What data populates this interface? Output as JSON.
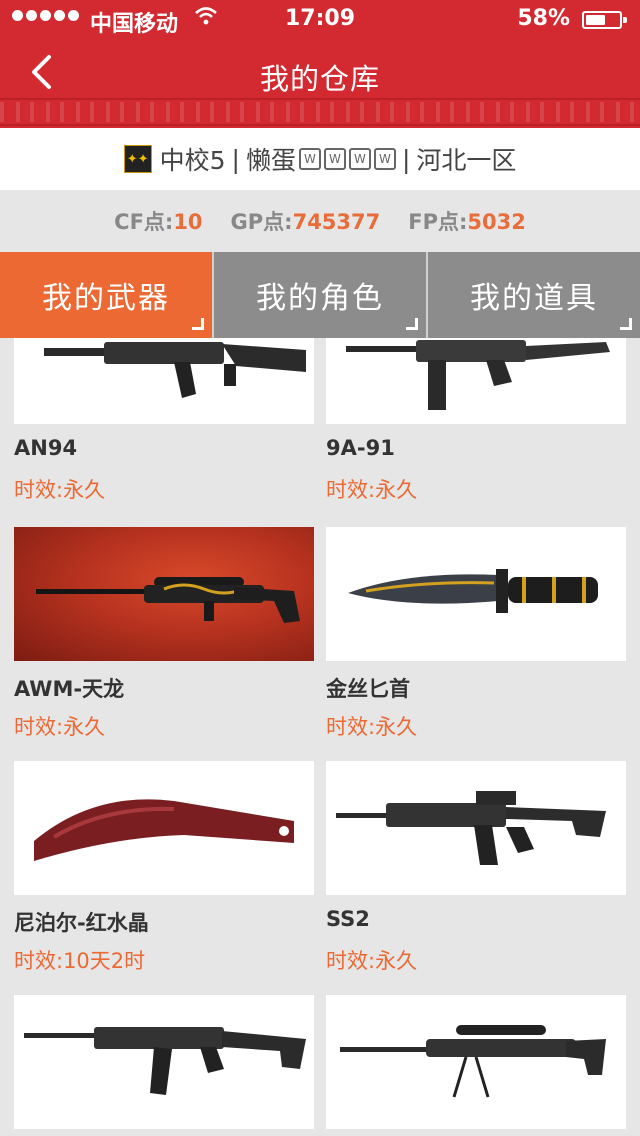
{
  "status": {
    "carrier": "中国移动",
    "time": "17:09",
    "battery": "58%",
    "battery_level": 0.58
  },
  "nav": {
    "title": "我的仓库"
  },
  "profile": {
    "rank": "中校5",
    "name": "懒蛋",
    "server": "河北一区"
  },
  "points": {
    "cf_label": "CF点:",
    "cf_value": "10",
    "gp_label": "GP点:",
    "gp_value": "745377",
    "fp_label": "FP点:",
    "fp_value": "5032"
  },
  "tabs": [
    {
      "label": "我的武器",
      "active": true
    },
    {
      "label": "我的角色",
      "active": false
    },
    {
      "label": "我的道具",
      "active": false
    }
  ],
  "items": [
    {
      "name": "AN94",
      "expiry": "时效:永久",
      "icon": "rifle-icon"
    },
    {
      "name": "9A-91",
      "expiry": "时效:永久",
      "icon": "rifle-icon"
    },
    {
      "name": "AWM-天龙",
      "expiry": "时效:永久",
      "icon": "sniper-rifle-icon"
    },
    {
      "name": "金丝匕首",
      "expiry": "时效:永久",
      "icon": "knife-icon"
    },
    {
      "name": "尼泊尔-红水晶",
      "expiry": "时效:10天2时",
      "icon": "kukri-icon"
    },
    {
      "name": "SS2",
      "expiry": "时效:永久",
      "icon": "rifle-icon"
    },
    {
      "name": "",
      "expiry": "",
      "icon": "rifle-icon"
    },
    {
      "name": "",
      "expiry": "",
      "icon": "sniper-rifle-icon"
    }
  ],
  "colors": {
    "header": "#d22a30",
    "tab_active": "#ec6934",
    "tab_inactive": "#8c8c8c",
    "accent": "#e86d3a"
  }
}
